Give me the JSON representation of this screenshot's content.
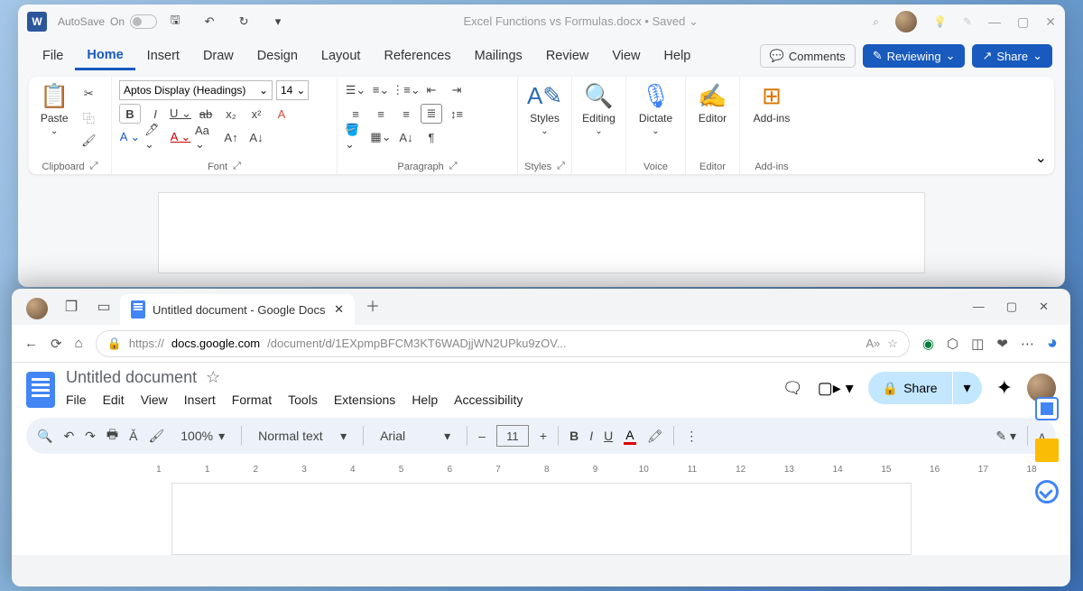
{
  "word": {
    "autosave_label": "AutoSave",
    "toggle_on": "On",
    "title": "Excel Functions vs Formulas.docx • Saved",
    "tabs": [
      "File",
      "Home",
      "Insert",
      "Draw",
      "Design",
      "Layout",
      "References",
      "Mailings",
      "Review",
      "View",
      "Help"
    ],
    "active_tab": "Home",
    "comments": "Comments",
    "reviewing": "Reviewing",
    "share": "Share",
    "font_name": "Aptos Display (Headings)",
    "font_size": "14",
    "groups": {
      "clipboard": "Clipboard",
      "font": "Font",
      "paragraph": "Paragraph",
      "styles": "Styles",
      "editing": "Editing",
      "voice": "Voice",
      "editor": "Editor",
      "addins": "Add-ins"
    },
    "paste": "Paste",
    "styles": "Styles",
    "editing": "Editing",
    "dictate": "Dictate",
    "editor": "Editor",
    "addins": "Add-ins"
  },
  "browser": {
    "tab_title": "Untitled document - Google Docs",
    "url_prefix": "https://",
    "url_host": "docs.google.com",
    "url_path": "/document/d/1EXpmpBFCM3KT6WADjjWN2UPku9zOV..."
  },
  "docs": {
    "title": "Untitled document",
    "menu": [
      "File",
      "Edit",
      "View",
      "Insert",
      "Format",
      "Tools",
      "Extensions",
      "Help",
      "Accessibility"
    ],
    "share": "Share",
    "zoom": "100%",
    "style": "Normal text",
    "font": "Arial",
    "font_size": "11",
    "ruler": [
      "1",
      "1",
      "2",
      "3",
      "4",
      "5",
      "6",
      "7",
      "8",
      "9",
      "10",
      "11",
      "12",
      "13",
      "14",
      "15",
      "16",
      "17",
      "18"
    ]
  }
}
